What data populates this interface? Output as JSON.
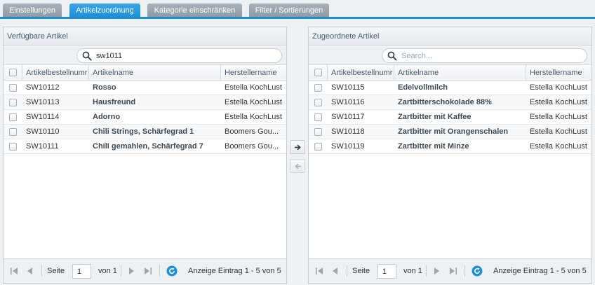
{
  "tabs": [
    {
      "label": "Einstellungen",
      "active": false
    },
    {
      "label": "Artikelzuordnung",
      "active": true
    },
    {
      "label": "Kategorie einschränken",
      "active": false
    },
    {
      "label": "Filter / Sortierungen",
      "active": false
    }
  ],
  "colors": {
    "accent": "#1e8fd6",
    "tab_inactive": "#9aa4ae",
    "header_text": "#475c6e"
  },
  "available": {
    "title": "Verfügbare Artikel",
    "search_value": "sw1011",
    "search_placeholder": "",
    "columns": [
      "Artikelbestellnumr",
      "Artikelname",
      "Herstellername"
    ],
    "rows": [
      {
        "number": "SW10112",
        "name": "Rosso",
        "manufacturer": "Estella KochLust"
      },
      {
        "number": "SW10113",
        "name": "Hausfreund",
        "manufacturer": "Estella KochLust"
      },
      {
        "number": "SW10114",
        "name": "Adorno",
        "manufacturer": "Estella KochLust"
      },
      {
        "number": "SW10110",
        "name": "Chili Strings, Schärfegrad 1",
        "manufacturer": "Boomers Gou..."
      },
      {
        "number": "SW10111",
        "name": "Chili gemahlen, Schärfegrad 7",
        "manufacturer": "Boomers Gou..."
      }
    ],
    "pager": {
      "page_label": "Seite",
      "page": "1",
      "of_label": "von 1",
      "display": "Anzeige Eintrag 1 - 5 von 5"
    }
  },
  "assigned": {
    "title": "Zugeordnete Artikel",
    "search_value": "",
    "search_placeholder": "Search...",
    "columns": [
      "Artikelbestellnumr",
      "Artikelname",
      "Herstellername"
    ],
    "rows": [
      {
        "number": "SW10115",
        "name": "Edelvollmilch",
        "manufacturer": "Estella KochLust"
      },
      {
        "number": "SW10116",
        "name": "Zartbitterschokolade 88%",
        "manufacturer": "Estella KochLust"
      },
      {
        "number": "SW10117",
        "name": "Zartbitter mit Kaffee",
        "manufacturer": "Estella KochLust"
      },
      {
        "number": "SW10118",
        "name": "Zartbitter mit Orangenschalen",
        "manufacturer": "Estella KochLust"
      },
      {
        "number": "SW10119",
        "name": "Zartbitter mit Minze",
        "manufacturer": "Estella KochLust"
      }
    ],
    "pager": {
      "page_label": "Seite",
      "page": "1",
      "of_label": "von 1",
      "display": "Anzeige Eintrag 1 - 5 von 5"
    }
  },
  "icons": {
    "move_right": "arrow-right-icon",
    "move_left": "arrow-left-icon",
    "refresh": "refresh-icon",
    "search": "search-icon"
  }
}
